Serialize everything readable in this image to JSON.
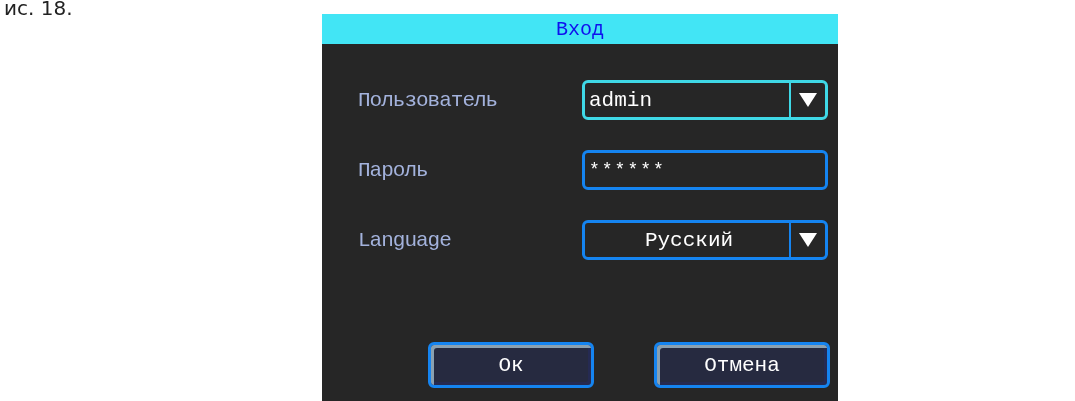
{
  "caption": "ис. 18.",
  "dialog": {
    "title": "Вход",
    "fields": [
      {
        "kind": "combo",
        "label": "Пользователь",
        "value": "admin",
        "selected": true
      },
      {
        "kind": "password",
        "label": "Пароль",
        "value": "******",
        "selected": false
      },
      {
        "kind": "select",
        "label": "Language",
        "value": "Русский",
        "selected": false
      }
    ],
    "buttons": [
      "Ок",
      "Отмена"
    ]
  }
}
